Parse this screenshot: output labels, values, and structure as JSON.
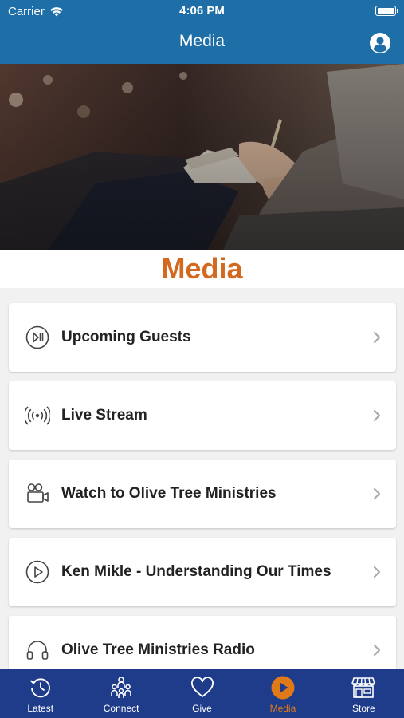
{
  "status_bar": {
    "carrier": "Carrier",
    "time": "4:06 PM"
  },
  "header": {
    "title": "Media"
  },
  "page": {
    "title": "Media"
  },
  "menu": {
    "items": [
      {
        "label": "Upcoming Guests",
        "icon": "play-pause-icon"
      },
      {
        "label": "Live Stream",
        "icon": "broadcast-icon"
      },
      {
        "label": "Watch to Olive Tree Ministries",
        "icon": "video-camera-icon"
      },
      {
        "label": "Ken Mikle - Understanding Our Times",
        "icon": "play-circle-icon"
      },
      {
        "label": "Olive Tree Ministries Radio",
        "icon": "headphones-icon"
      }
    ]
  },
  "tabbar": {
    "items": [
      {
        "label": "Latest",
        "icon": "history-icon"
      },
      {
        "label": "Connect",
        "icon": "people-icon"
      },
      {
        "label": "Give",
        "icon": "heart-icon"
      },
      {
        "label": "Media",
        "icon": "play-circle-icon",
        "active": true
      },
      {
        "label": "Store",
        "icon": "storefront-icon"
      }
    ]
  },
  "colors": {
    "header_bg": "#1e6fa8",
    "tabbar_bg": "#1e3c8a",
    "accent": "#d2691e",
    "active_tab": "#e07a18"
  }
}
